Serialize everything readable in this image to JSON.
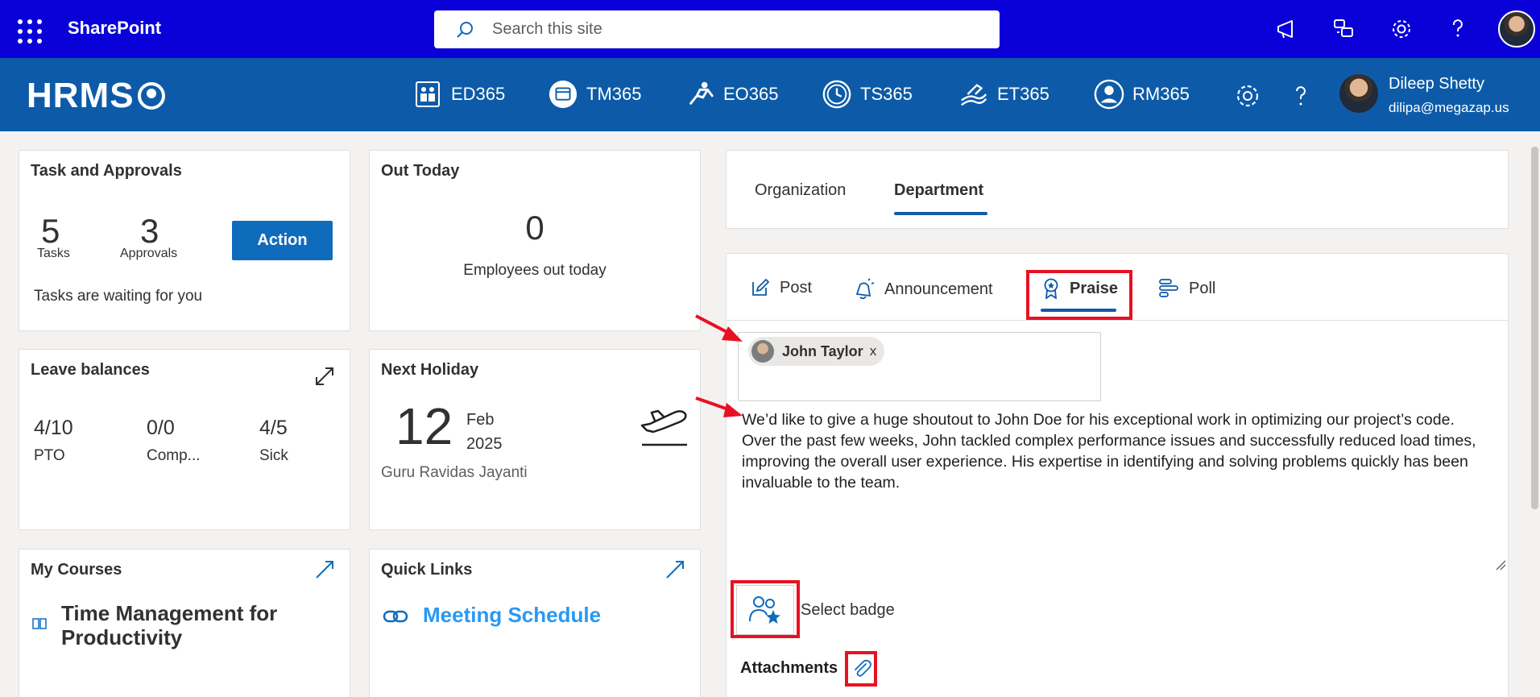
{
  "suite": {
    "title": "SharePoint",
    "search_placeholder": "Search this site"
  },
  "header": {
    "logo": "HRMS",
    "nav": [
      {
        "label": "ED365",
        "icon": "ed365-icon"
      },
      {
        "label": "TM365",
        "icon": "tm365-icon"
      },
      {
        "label": "EO365",
        "icon": "eo365-icon"
      },
      {
        "label": "TS365",
        "icon": "ts365-icon"
      },
      {
        "label": "ET365",
        "icon": "et365-icon"
      },
      {
        "label": "RM365",
        "icon": "rm365-icon"
      }
    ],
    "user": {
      "name": "Dileep Shetty",
      "email": "dilipa@megazap.us"
    }
  },
  "tasks": {
    "title": "Task and Approvals",
    "tasks_count": "5",
    "tasks_label": "Tasks",
    "approvals_count": "3",
    "approvals_label": "Approvals",
    "action_label": "Action",
    "message": "Tasks are waiting for you"
  },
  "out_today": {
    "title": "Out Today",
    "count": "0",
    "label": "Employees out today"
  },
  "leave": {
    "title": "Leave balances",
    "items": [
      {
        "value": "4/10",
        "label": "PTO"
      },
      {
        "value": "0/0",
        "label": "Comp..."
      },
      {
        "value": "4/5",
        "label": "Sick"
      }
    ]
  },
  "holiday": {
    "title": "Next Holiday",
    "day": "12",
    "month": "Feb",
    "year": "2025",
    "name": "Guru Ravidas Jayanti"
  },
  "courses": {
    "title": "My Courses",
    "course": "Time Management for Productivity"
  },
  "quick_links": {
    "title": "Quick Links",
    "link": "Meeting Schedule"
  },
  "feed": {
    "tabs": [
      "Organization",
      "Department"
    ],
    "active_tab": "Department",
    "post_tabs": [
      "Post",
      "Announcement",
      "Praise",
      "Poll"
    ],
    "active_post_tab": "Praise",
    "recipient": "John Taylor",
    "remove": "x",
    "message": "We’d like to give a huge shoutout to John Doe for his exceptional work in optimizing our project’s code. Over the past few weeks, John tackled complex performance issues and successfully reduced load times, improving the overall user experience. His expertise in identifying and solving problems quickly has been invaluable to the team.",
    "badge_label": "Select badge",
    "attachments_label": "Attachments"
  },
  "colors": {
    "suite_bg": "#0a00d8",
    "header_bg": "#0d5ba8",
    "accent": "#0f6cbd",
    "highlight": "#e81123"
  }
}
